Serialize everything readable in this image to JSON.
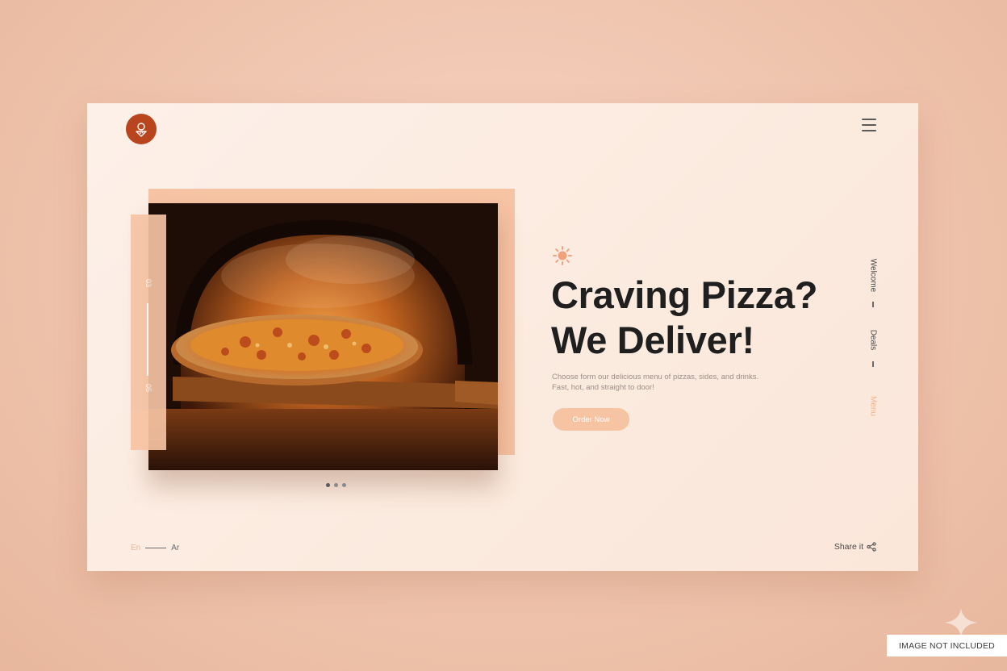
{
  "side_panel": {
    "top_label": "03",
    "bottom_label": "05"
  },
  "hero": {
    "headline_line1": "Craving Pizza?",
    "headline_line2": "We Deliver!",
    "sub_line1": "Choose form our delicious menu of pizzas, sides, and drinks.",
    "sub_line2": "Fast, hot, and straight to door!",
    "cta_label": "Order Now"
  },
  "vertical_nav": {
    "items": [
      {
        "label": "Welcome",
        "active": false
      },
      {
        "label": "Deals",
        "active": false
      },
      {
        "label": "Menu",
        "active": true
      }
    ]
  },
  "carousel": {
    "total_dots": 3,
    "active_index": 0
  },
  "footer": {
    "lang_primary": "En",
    "lang_secondary": "Ar",
    "share_label": "Share it"
  },
  "watermark": {
    "label": "IMAGE NOT INCLUDED"
  },
  "colors": {
    "accent": "#f2b48e",
    "brand": "#b8451d",
    "text_dark": "#1f1f1f",
    "backdrop": "#efc4ad"
  },
  "icons": {
    "logo": "pizza-logo-icon",
    "menu": "hamburger-icon",
    "sun": "sun-icon",
    "share": "share-icon"
  }
}
